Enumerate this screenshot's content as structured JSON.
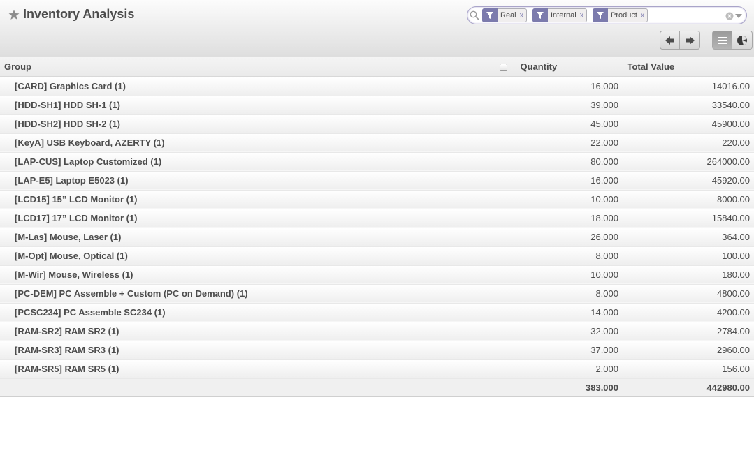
{
  "header": {
    "title": "Inventory Analysis"
  },
  "search": {
    "facets": [
      {
        "value": "Real",
        "remove": "x"
      },
      {
        "value": "Internal",
        "remove": "x"
      },
      {
        "value": "Product",
        "remove": "x"
      }
    ],
    "input_value": "",
    "icons": {
      "search": "search-icon",
      "filter": "funnel-icon",
      "clear": "clear-circle-icon",
      "dropdown": "caret-down-icon"
    }
  },
  "toolbar": {
    "prev_icon": "arrow-left-icon",
    "next_icon": "arrow-right-icon",
    "list_view_icon": "list-icon",
    "graph_view_icon": "pie-chart-icon",
    "active_view": "list"
  },
  "table": {
    "columns": {
      "group": "Group",
      "quantity": "Quantity",
      "total_value": "Total Value"
    },
    "rows": [
      {
        "group": "[CARD] Graphics Card (1)",
        "quantity": "16.000",
        "total_value": "14016.00"
      },
      {
        "group": "[HDD-SH1] HDD SH-1 (1)",
        "quantity": "39.000",
        "total_value": "33540.00"
      },
      {
        "group": "[HDD-SH2] HDD SH-2 (1)",
        "quantity": "45.000",
        "total_value": "45900.00"
      },
      {
        "group": "[KeyA] USB Keyboard, AZERTY (1)",
        "quantity": "22.000",
        "total_value": "220.00"
      },
      {
        "group": "[LAP-CUS] Laptop Customized (1)",
        "quantity": "80.000",
        "total_value": "264000.00"
      },
      {
        "group": "[LAP-E5] Laptop E5023 (1)",
        "quantity": "16.000",
        "total_value": "45920.00"
      },
      {
        "group": "[LCD15] 15” LCD Monitor (1)",
        "quantity": "10.000",
        "total_value": "8000.00"
      },
      {
        "group": "[LCD17] 17” LCD Monitor (1)",
        "quantity": "18.000",
        "total_value": "15840.00"
      },
      {
        "group": "[M-Las] Mouse, Laser (1)",
        "quantity": "26.000",
        "total_value": "364.00"
      },
      {
        "group": "[M-Opt] Mouse, Optical (1)",
        "quantity": "8.000",
        "total_value": "100.00"
      },
      {
        "group": "[M-Wir] Mouse, Wireless (1)",
        "quantity": "10.000",
        "total_value": "180.00"
      },
      {
        "group": "[PC-DEM] PC Assemble + Custom (PC on Demand) (1)",
        "quantity": "8.000",
        "total_value": "4800.00"
      },
      {
        "group": "[PCSC234] PC Assemble SC234 (1)",
        "quantity": "14.000",
        "total_value": "4200.00"
      },
      {
        "group": "[RAM-SR2] RAM SR2 (1)",
        "quantity": "32.000",
        "total_value": "2784.00"
      },
      {
        "group": "[RAM-SR3] RAM SR3 (1)",
        "quantity": "37.000",
        "total_value": "2960.00"
      },
      {
        "group": "[RAM-SR5] RAM SR5 (1)",
        "quantity": "2.000",
        "total_value": "156.00"
      }
    ],
    "totals": {
      "quantity": "383.000",
      "total_value": "442980.00"
    }
  }
}
